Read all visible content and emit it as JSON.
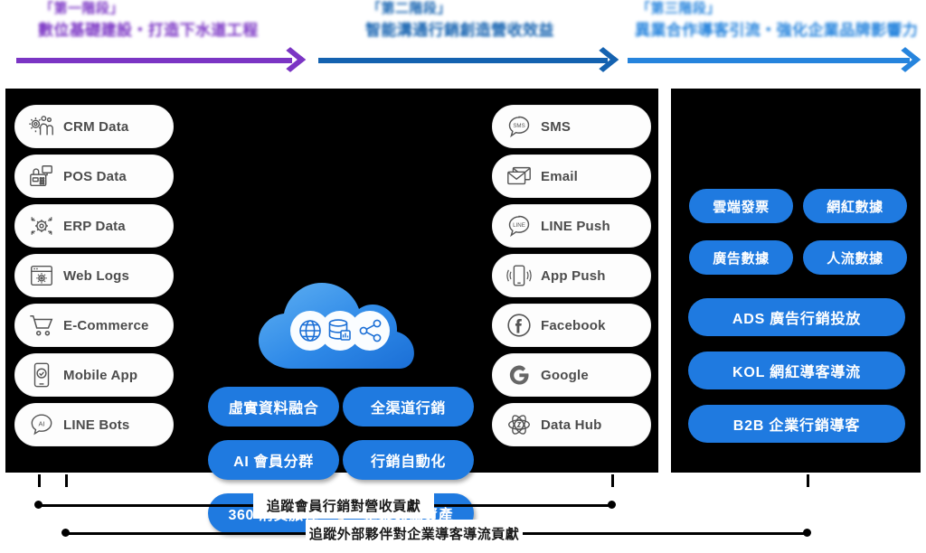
{
  "headers": [
    {
      "tag": "「第一階段」",
      "title": "數位基礎建設・打造下水道工程",
      "color": "#7b35c4",
      "arrow_icon": "arrow-right-icon"
    },
    {
      "tag": "「第二階段」",
      "title": "智能溝通行銷創造營收效益",
      "color": "#1462b0",
      "arrow_icon": "arrow-right-icon"
    },
    {
      "tag": "「第三階段」",
      "title": "異業合作導客引流・強化企業品牌影響力",
      "color": "#2684dd",
      "arrow_icon": "arrow-right-icon"
    }
  ],
  "data_sources": {
    "panel_label": "data-sources",
    "items": [
      {
        "label": "CRM Data",
        "icon": "crm-users-gear-icon"
      },
      {
        "label": "POS Data",
        "icon": "pos-terminal-icon"
      },
      {
        "label": "ERP Data",
        "icon": "erp-gear-arrows-icon"
      },
      {
        "label": "Web Logs",
        "icon": "browser-window-gear-icon"
      },
      {
        "label": "E-Commerce",
        "icon": "shopping-cart-icon"
      },
      {
        "label": "Mobile App",
        "icon": "mobile-check-icon"
      },
      {
        "label": "LINE Bots",
        "icon": "ai-chat-bubble-icon"
      }
    ]
  },
  "channels": {
    "panel_label": "marketing-channels",
    "items": [
      {
        "label": "SMS",
        "icon": "sms-bubble-icon"
      },
      {
        "label": "Email",
        "icon": "envelope-icon"
      },
      {
        "label": "LINE Push",
        "icon": "line-bubble-icon"
      },
      {
        "label": "App Push",
        "icon": "app-push-phone-icon"
      },
      {
        "label": "Facebook",
        "icon": "facebook-icon"
      },
      {
        "label": "Google",
        "icon": "google-g-icon"
      },
      {
        "label": "Data Hub",
        "icon": "data-hub-atom-icon"
      }
    ]
  },
  "cloud": {
    "name": "data-cloud-platform",
    "color": "#2f8ae8",
    "icons": [
      "globe-icon",
      "database-chart-icon",
      "share-network-icon"
    ]
  },
  "capabilities": {
    "panel_label": "platform-capabilities",
    "color": "#1f7ae0",
    "items": [
      "虛實資料融合",
      "全渠道行銷",
      "AI 會員分群",
      "行銷自動化",
      "360 消費旅程",
      "企業數據資產"
    ]
  },
  "external": {
    "panel_label": "external-partners",
    "color": "#1f7ae0",
    "data_items": [
      "雲端發票",
      "網紅數據",
      "廣告數據",
      "人流數據"
    ],
    "service_items": [
      "ADS  廣告行銷投放",
      "KOL  網紅導客導流",
      "B2B  企業行銷導客"
    ]
  },
  "notes": [
    {
      "text": "追蹤會員行銷對營收貢獻",
      "name": "note-member-revenue"
    },
    {
      "text": "追蹤外部夥伴對企業導客導流貢獻",
      "name": "note-partner-referral"
    }
  ]
}
